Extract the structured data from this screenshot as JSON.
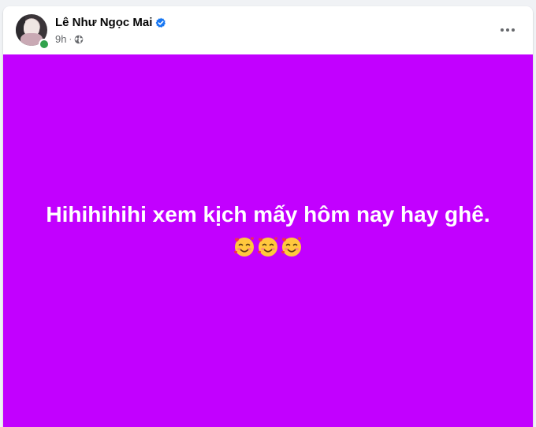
{
  "post": {
    "author_name": "Lê Như Ngọc Mai",
    "verified": true,
    "time": "9h",
    "separator": "·",
    "audience_icon": "globe-icon",
    "more_icon": "more-horizontal-icon",
    "status_text": "Hihihihihi xem kịch mấy hôm nay hay ghê.",
    "emojis": [
      "smiling-face-with-hearts",
      "smiling-face-with-hearts",
      "smiling-face-with-hearts"
    ],
    "background_color": "#c200ff",
    "text_color": "#ffffff",
    "verified_color": "#1877f2",
    "online_color": "#31a24c"
  }
}
